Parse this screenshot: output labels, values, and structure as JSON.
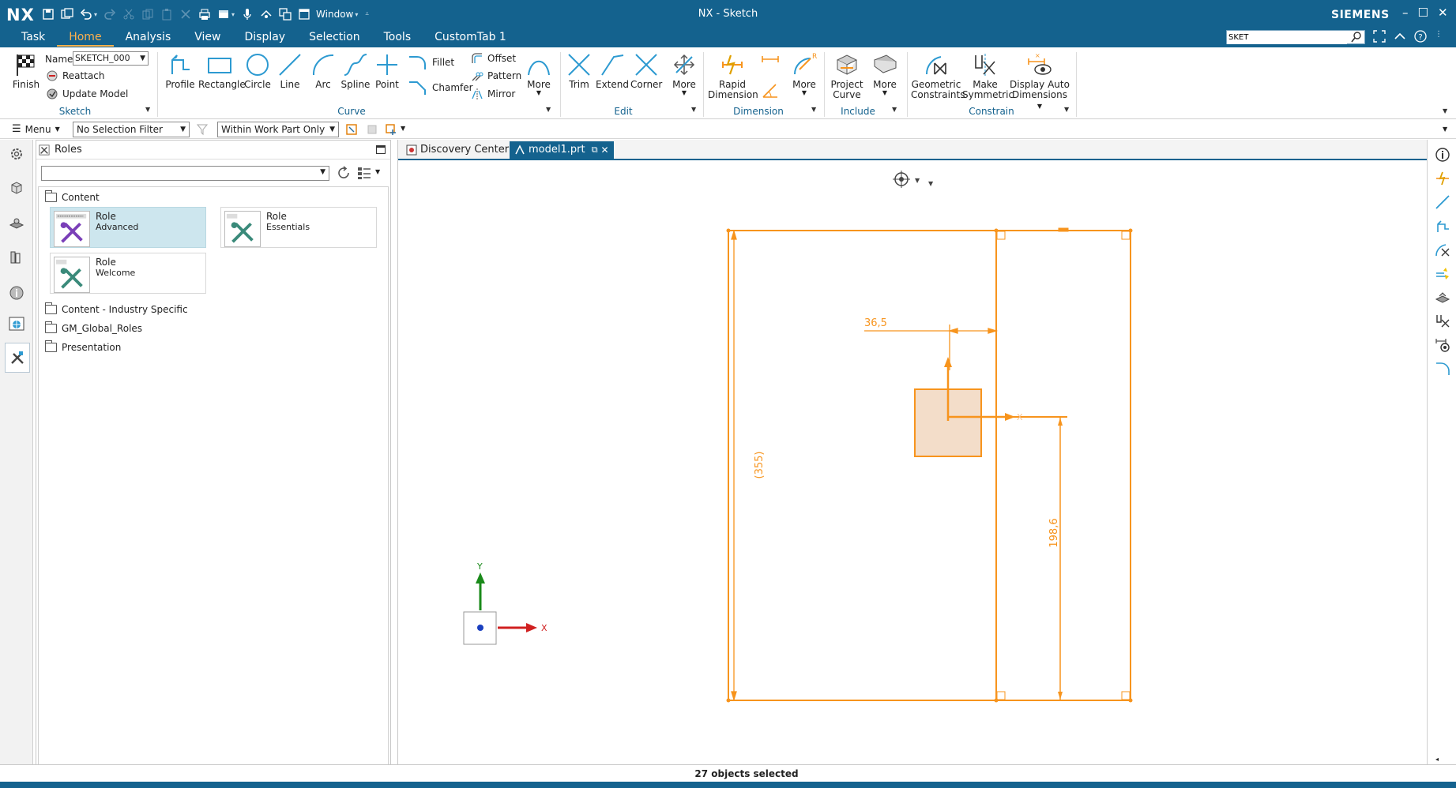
{
  "app": {
    "logo": "NX",
    "title": "NX - Sketch",
    "brand": "SIEMENS",
    "window_menu": "Window",
    "command_search": "SKET"
  },
  "ribbon_tabs": [
    "Task",
    "Home",
    "Analysis",
    "View",
    "Display",
    "Selection",
    "Tools",
    "CustomTab 1"
  ],
  "active_tab": "Home",
  "ribbon": {
    "sketch_group": {
      "label": "Sketch",
      "finish": "Finish",
      "name_label": "Name",
      "name_value": "SKETCH_000",
      "reattach": "Reattach",
      "update_model": "Update Model"
    },
    "curve_group": {
      "label": "Curve",
      "profile": "Profile",
      "rectangle": "Rectangle",
      "circle": "Circle",
      "line": "Line",
      "arc": "Arc",
      "spline": "Spline",
      "point": "Point",
      "fillet": "Fillet",
      "chamfer": "Chamfer",
      "offset": "Offset",
      "pattern": "Pattern",
      "mirror": "Mirror",
      "more": "More"
    },
    "edit_group": {
      "label": "Edit",
      "trim": "Trim",
      "extend": "Extend",
      "corner": "Corner",
      "more": "More"
    },
    "dimension_group": {
      "label": "Dimension",
      "rapid_l1": "Rapid",
      "rapid_l2": "Dimension",
      "more": "More"
    },
    "include_group": {
      "label": "Include",
      "project_l1": "Project",
      "project_l2": "Curve",
      "more": "More"
    },
    "constrain_group": {
      "label": "Constrain",
      "geo_l1": "Geometric",
      "geo_l2": "Constraints",
      "sym_l1": "Make",
      "sym_l2": "Symmetric",
      "auto_l1": "Display Auto",
      "auto_l2": "Dimensions"
    }
  },
  "selection_bar": {
    "menu": "Menu",
    "filter": "No Selection Filter",
    "scope": "Within Work Part Only"
  },
  "roles_panel": {
    "title": "Roles",
    "folders": {
      "content": "Content",
      "industry": "Content - Industry Specific",
      "gm": "GM_Global_Roles",
      "presentation": "Presentation"
    },
    "cards": [
      {
        "title": "Role",
        "subtitle": "Advanced"
      },
      {
        "title": "Role",
        "subtitle": "Essentials"
      },
      {
        "title": "Role",
        "subtitle": "Welcome"
      }
    ]
  },
  "doc_tabs": {
    "discovery": "Discovery Center",
    "model": "model1.prt"
  },
  "sketch": {
    "dim_horizontal": "36,5",
    "dim_vertical_ref": "(355)",
    "dim_vertical": "198,6",
    "axis_x": "X",
    "axis_y": "Y",
    "sketch_color": "#f7941d"
  },
  "status": {
    "message": "27 objects selected"
  },
  "colors": {
    "titlebar": "#14628e",
    "accent": "#ffb14d",
    "sketch": "#f7941d"
  }
}
